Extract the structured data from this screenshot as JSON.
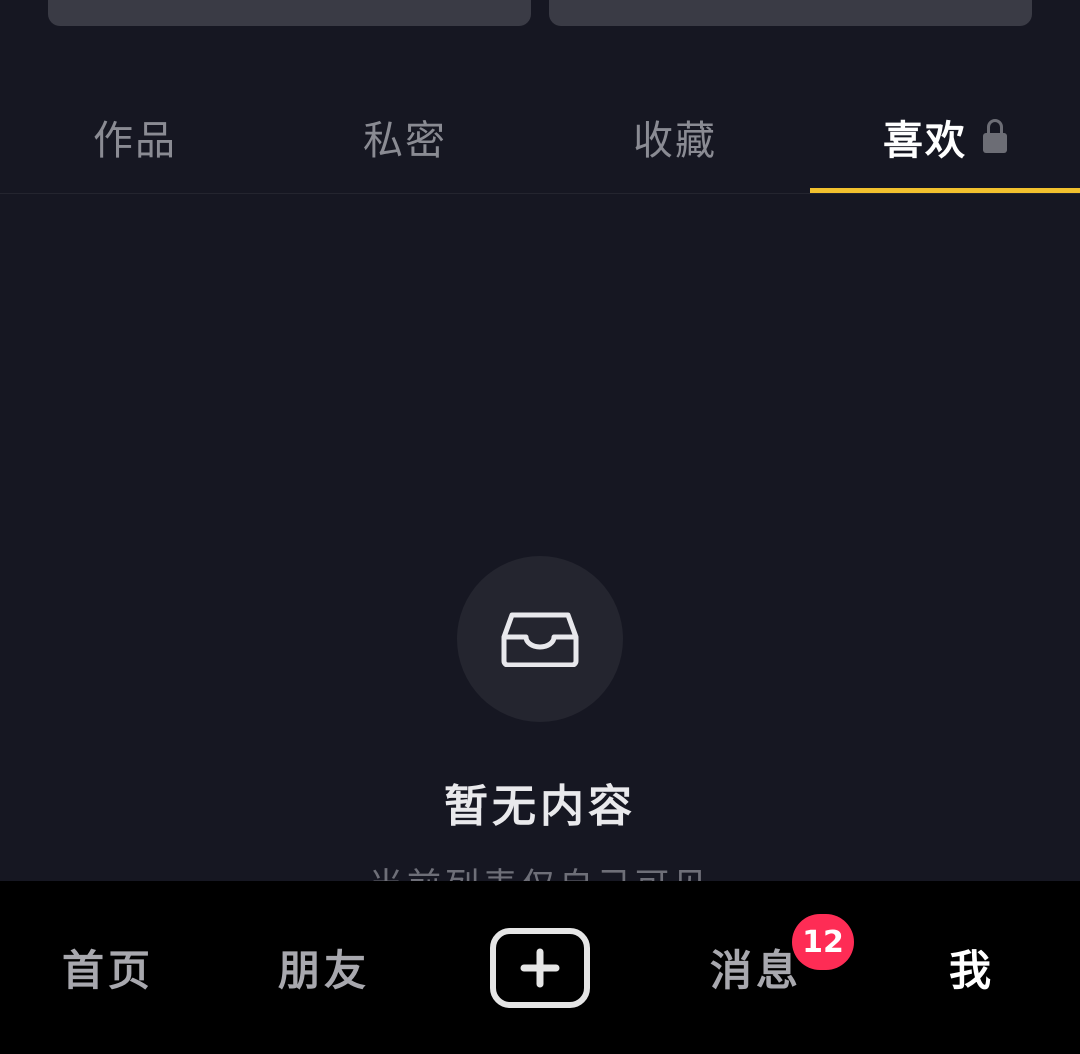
{
  "tabs": [
    {
      "label": "作品"
    },
    {
      "label": "私密"
    },
    {
      "label": "收藏"
    },
    {
      "label": "喜欢"
    }
  ],
  "active_tab_index": 3,
  "empty_state": {
    "title": "暂无内容",
    "subtitle": "当前列表仅自己可见",
    "icon": "inbox-icon"
  },
  "bottom_nav": {
    "items": [
      {
        "label": "首页"
      },
      {
        "label": "朋友"
      },
      {
        "label": ""
      },
      {
        "label": "消息"
      },
      {
        "label": "我"
      }
    ],
    "messages_badge": "12"
  },
  "colors": {
    "background": "#161722",
    "accent_underline": "#f2c12e",
    "badge": "#fe2c55"
  }
}
